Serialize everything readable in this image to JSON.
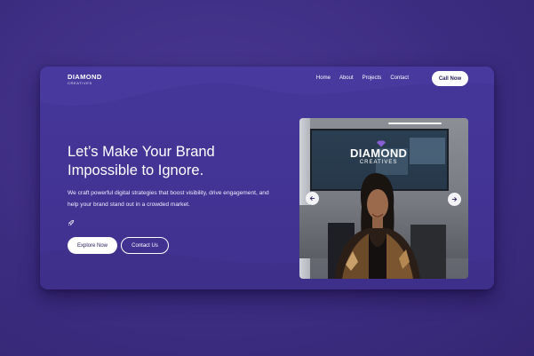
{
  "brand": {
    "name": "DIAMOND",
    "tagline": "CREATIVES"
  },
  "nav": {
    "items": [
      {
        "label": "Home"
      },
      {
        "label": "About"
      },
      {
        "label": "Projects"
      },
      {
        "label": "Contact"
      }
    ],
    "call_label": "Call Now"
  },
  "hero": {
    "title_line1": "Let’s Make Your Brand",
    "title_line2": "Impossible to Ignore.",
    "description": "We craft powerful digital strategies that boost visibility, drive engagement, and help your brand stand out in a crowded market.",
    "primary_button": "Explore Now",
    "secondary_button": "Contact Us"
  },
  "photo": {
    "sign_title": "DIAMOND",
    "sign_subtitle": "CREATIVES"
  },
  "icons": {
    "rocket": "rocket-icon",
    "prev": "arrow-left-icon",
    "next": "arrow-right-icon"
  },
  "colors": {
    "background": "#3d2d82",
    "card": "#45369a",
    "button_text": "#2b2160",
    "white": "#ffffff"
  }
}
